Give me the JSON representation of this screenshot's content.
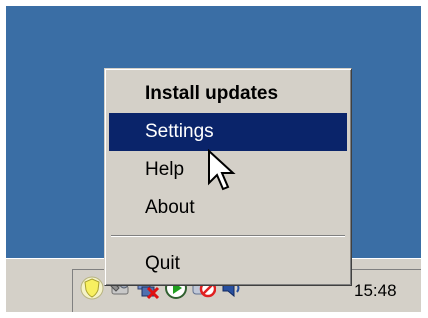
{
  "menu": {
    "items": [
      {
        "label": "Install updates",
        "bold": true
      },
      {
        "label": "Settings",
        "selected": true
      },
      {
        "label": "Help"
      },
      {
        "label": "About"
      },
      {
        "label": "Quit"
      }
    ]
  },
  "taskbar": {
    "clock": "15:48",
    "tray_icons": [
      "update-shield-icon",
      "network-tool-icon",
      "network-disconnected-icon",
      "media-player-icon",
      "blocked-service-icon",
      "volume-icon"
    ]
  },
  "colors": {
    "desktop": "#3a6ea5",
    "menu_background": "#d4d0c8",
    "selection": "#0a246a"
  }
}
